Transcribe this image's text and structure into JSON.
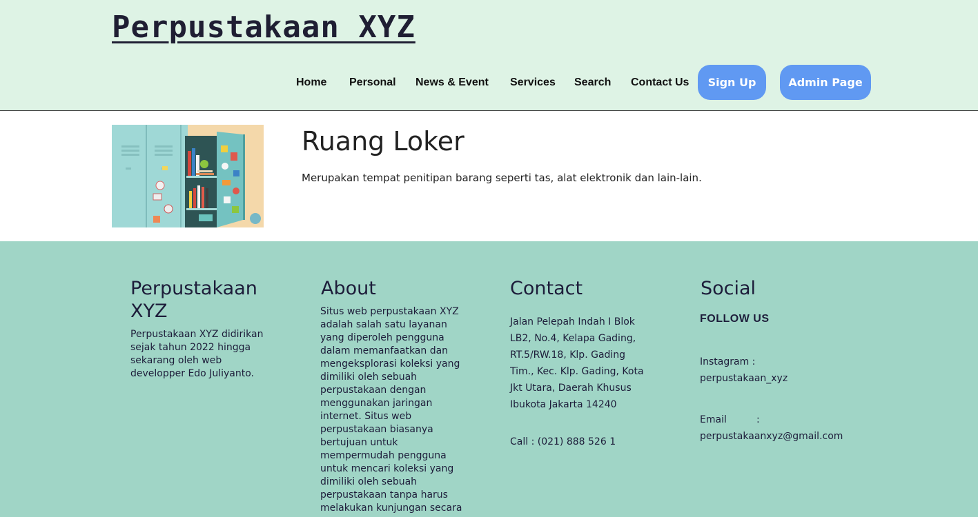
{
  "header": {
    "site_title": "Perpustakaan XYZ",
    "nav": [
      "Home",
      "Personal",
      "News & Event",
      "Services",
      "Search",
      "Contact Us"
    ],
    "signup_label": "Sign Up",
    "admin_label": "Admin Page"
  },
  "main": {
    "title": "Ruang Loker",
    "description": "Merupakan tempat penitipan barang seperti tas, alat elektronik dan lain-lain."
  },
  "footer": {
    "brand": {
      "title_line1": "Perpustakaan",
      "title_line2": "XYZ",
      "text": [
        "Perpustakaan XYZ didirikan",
        "sejak tahun 2022 hingga",
        "sekarang oleh web",
        "developper Edo Juliyanto."
      ]
    },
    "about": {
      "title": "About",
      "text": [
        "Situs web perpustakaan XYZ",
        "adalah salah satu layanan",
        "yang diperoleh pengguna",
        "dalam memanfaatkan dan",
        "mengeksplorasi koleksi yang",
        "dimiliki oleh sebuah",
        "perpustakaan dengan",
        "menggunakan jaringan",
        "internet. Situs web",
        "perpustakaan biasanya",
        "bertujuan untuk",
        "mempermudah pengguna",
        "untuk mencari koleksi yang",
        "dimiliki oleh sebuah",
        "perpustakaan tanpa harus",
        "melakukan kunjungan secara"
      ]
    },
    "contact": {
      "title": "Contact",
      "address": [
        "Jalan Pelepah Indah I Blok",
        "LB2, No.4, Kelapa Gading,",
        "RT.5/RW.18, Klp. Gading",
        "Tim., Kec. Klp. Gading, Kota",
        "Jkt Utara, Daerah Khusus",
        "Ibukota Jakarta 14240"
      ],
      "call": "Call : (021) 888 526 1"
    },
    "social": {
      "title": "Social",
      "follow": "FOLLOW US",
      "instagram_label": "Instagram :",
      "instagram_value": "perpustakaan_xyz",
      "email_label": "Email",
      "email_colon": ":",
      "email_value": "perpustakaanxyz@gmail.com"
    }
  }
}
